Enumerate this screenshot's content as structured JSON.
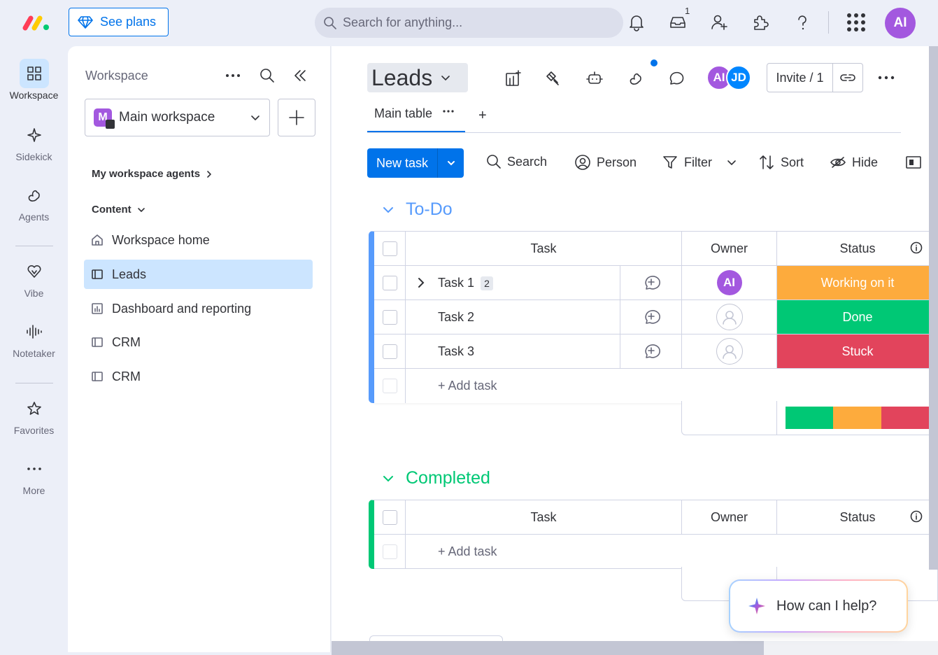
{
  "topbar": {
    "see_plans": "See plans",
    "search_placeholder": "Search for anything...",
    "inbox_count": "1",
    "user_initials": "AI",
    "icons": [
      "bell-icon",
      "inbox-icon",
      "invite-user-icon",
      "puzzle-icon",
      "help-icon",
      "apps-grid-icon"
    ]
  },
  "rail": {
    "items": [
      {
        "label": "Workspace",
        "icon": "grid-icon"
      },
      {
        "label": "Sidekick",
        "icon": "sparkle-icon"
      },
      {
        "label": "Agents",
        "icon": "agents-icon"
      },
      {
        "label": "Vibe",
        "icon": "heart-icon"
      },
      {
        "label": "Notetaker",
        "icon": "waveform-icon"
      },
      {
        "label": "Favorites",
        "icon": "star-icon"
      },
      {
        "label": "More",
        "icon": "more-icon"
      }
    ]
  },
  "workspace": {
    "title": "Workspace",
    "badge": "M",
    "selected": "Main workspace",
    "agents_link": "My workspace agents",
    "content_header": "Content",
    "items": [
      {
        "label": "Workspace home",
        "icon": "home-icon"
      },
      {
        "label": "Leads",
        "icon": "board-icon",
        "active": true
      },
      {
        "label": "Dashboard and reporting",
        "icon": "dashboard-icon"
      },
      {
        "label": "CRM",
        "icon": "board-icon"
      },
      {
        "label": "CRM",
        "icon": "board-icon"
      }
    ]
  },
  "board": {
    "title": "Leads",
    "members": [
      {
        "initials": "AI",
        "color": "#a358df"
      },
      {
        "initials": "JD",
        "color": "#0086ff"
      }
    ],
    "invite_label": "Invite / 1",
    "tab_main": "Main table",
    "tab_add": "+",
    "toolbar": {
      "new_task": "New task",
      "search": "Search",
      "person": "Person",
      "filter": "Filter",
      "sort": "Sort",
      "hide": "Hide"
    },
    "columns": {
      "task": "Task",
      "owner": "Owner",
      "status": "Status"
    },
    "add_task": "+ Add task",
    "groups": [
      {
        "name": "To-Do",
        "color": "#579bfc",
        "tasks": [
          {
            "name": "Task 1",
            "subitems": "2",
            "owner": "AI",
            "status": "Working on it",
            "status_color": "#fdab3d"
          },
          {
            "name": "Task 2",
            "owner": "",
            "status": "Done",
            "status_color": "#00c875"
          },
          {
            "name": "Task 3",
            "owner": "",
            "status": "Stuck",
            "status_color": "#e2445c"
          }
        ],
        "status_summary": [
          {
            "color": "#00c875",
            "share": 0.333
          },
          {
            "color": "#fdab3d",
            "share": 0.333
          },
          {
            "color": "#e2445c",
            "share": 0.334
          }
        ]
      },
      {
        "name": "Completed",
        "color": "#00c875",
        "tasks": []
      }
    ]
  },
  "help": {
    "label": "How can I help?"
  }
}
